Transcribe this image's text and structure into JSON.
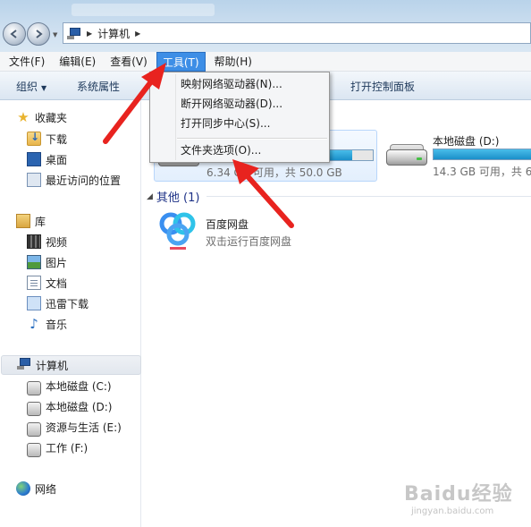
{
  "address": {
    "crumbs": [
      "计算机"
    ]
  },
  "menubar": [
    {
      "label": "文件(F)"
    },
    {
      "label": "编辑(E)"
    },
    {
      "label": "查看(V)"
    },
    {
      "label": "工具(T)",
      "active": true
    },
    {
      "label": "帮助(H)"
    }
  ],
  "toolbar": {
    "organize": "组织",
    "system_props": "系统属性",
    "control_panel": "打开控制面板"
  },
  "tools_menu": {
    "items": [
      "映射网络驱动器(N)...",
      "断开网络驱动器(D)...",
      "打开同步中心(S)...",
      "文件夹选项(O)..."
    ]
  },
  "sidebar": {
    "favorites": {
      "label": "收藏夹",
      "items": [
        "下载",
        "桌面",
        "最近访问的位置"
      ]
    },
    "libraries": {
      "label": "库",
      "items": [
        "视频",
        "图片",
        "文档",
        "迅雷下载",
        "音乐"
      ]
    },
    "computer": {
      "label": "计算机",
      "items": [
        "本地磁盘 (C:)",
        "本地磁盘 (D:)",
        "资源与生活 (E:)",
        "工作 (F:)"
      ]
    },
    "network": {
      "label": "网络"
    }
  },
  "drives": [
    {
      "name": "本地磁盘 (C:)",
      "size_text": "6.34 GB 可用，共 50.0 GB",
      "used_fraction": 0.87
    },
    {
      "name": "本地磁盘 (D:)",
      "size_text": "14.3 GB 可用，共 6",
      "used_fraction": 0.94
    }
  ],
  "other_group": {
    "title": "其他 (1)",
    "item": {
      "name": "百度网盘",
      "desc": "双击运行百度网盘"
    }
  },
  "watermark": {
    "main": "Baidu经验",
    "sub": "jingyan.baidu.com"
  },
  "colors": {
    "menu_active": "#3d8ee6",
    "arrow": "#e8231f",
    "drive_fill": "#1a8fc9"
  }
}
